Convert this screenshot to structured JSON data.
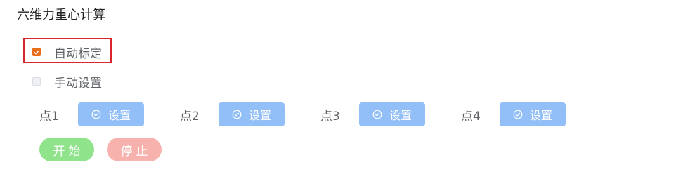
{
  "title": "六维力重心计算",
  "calibration": {
    "auto": {
      "label": "自动标定",
      "checked": true
    },
    "manual": {
      "label": "手动设置",
      "checked": false
    }
  },
  "points": [
    {
      "label": "点1",
      "button_label": "设置",
      "icon": "check-circle-icon"
    },
    {
      "label": "点2",
      "button_label": "设置",
      "icon": "check-circle-icon"
    },
    {
      "label": "点3",
      "button_label": "设置",
      "icon": "check-circle-icon"
    },
    {
      "label": "点4",
      "button_label": "设置",
      "icon": "check-circle-icon"
    }
  ],
  "actions": {
    "start_label": "开始",
    "stop_label": "停止"
  },
  "colors": {
    "checkbox_checked": "#e8701a",
    "set_button": "#93bff8",
    "start_button": "#8fe38a",
    "stop_button": "#f8b2ad",
    "highlight_border": "#d9262c"
  }
}
